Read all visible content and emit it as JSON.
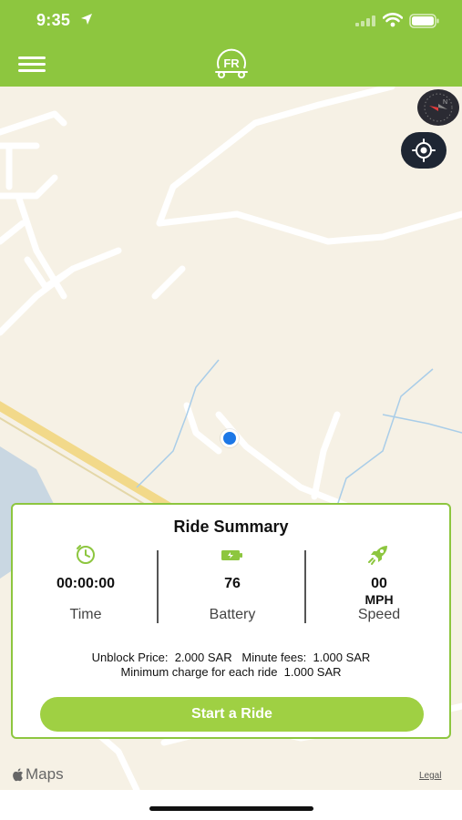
{
  "status_bar": {
    "time": "9:35"
  },
  "app": {
    "logo_text": "FR"
  },
  "colors": {
    "brand_green": "#8dc63f",
    "button_green": "#9fd043",
    "user_dot": "#1c77e6"
  },
  "map": {
    "attribution": "Maps",
    "legal": "Legal"
  },
  "ride_summary": {
    "title": "Ride Summary",
    "time": {
      "value": "00:00:00",
      "label": "Time",
      "icon": "clock-icon"
    },
    "battery": {
      "value": "76",
      "label": "Battery",
      "icon": "battery-icon"
    },
    "speed": {
      "value": "00",
      "unit": "MPH",
      "label": "Speed",
      "icon": "rocket-icon"
    },
    "fees_line1": "Unblock Price:  2.000 SAR   Minute fees:  1.000 SAR",
    "fees_line2": "Minimum charge for each ride  1.000 SAR",
    "start_button": "Start a Ride"
  }
}
